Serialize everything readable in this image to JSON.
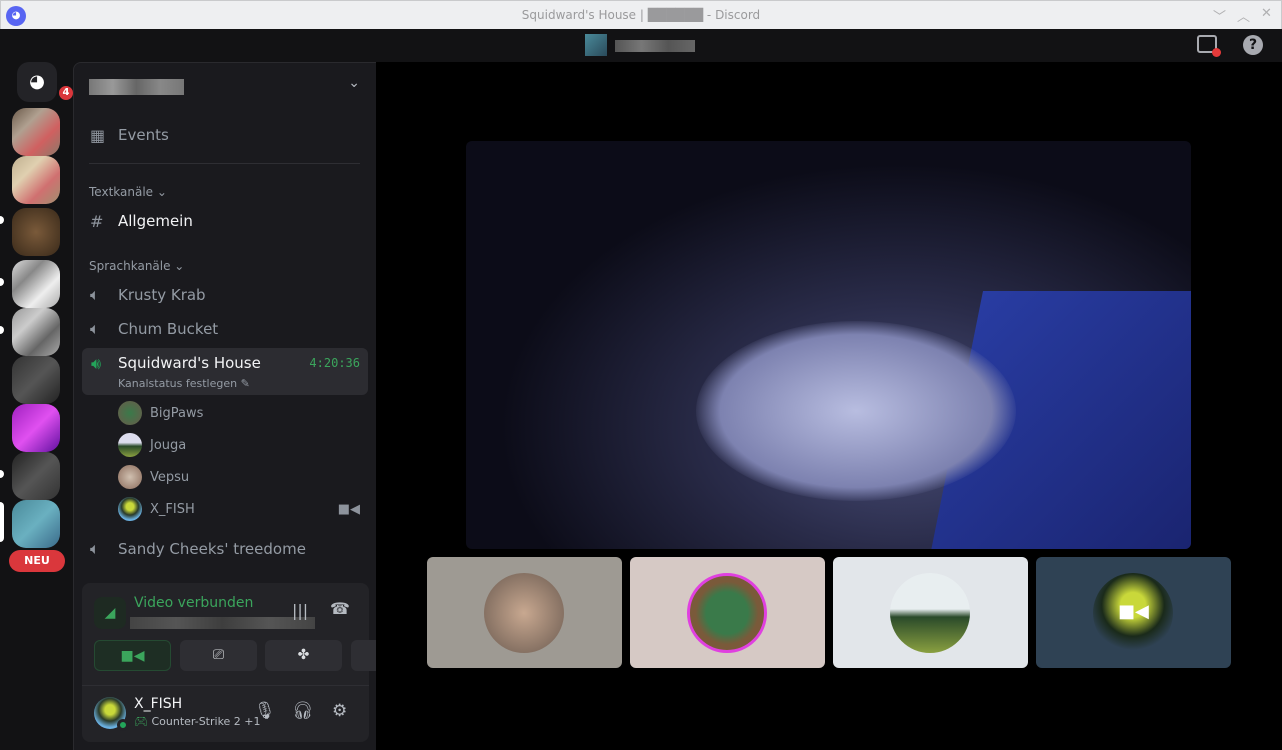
{
  "window": {
    "title": "Squidward's House | ██████ - Discord",
    "controls": {
      "minimize": "﹀",
      "maximize": "︿",
      "close": "✕"
    }
  },
  "topbar": {
    "inbox_icon": "inbox-icon",
    "help_label": "?"
  },
  "rail": {
    "home_badge": "4",
    "new_label": "NEU"
  },
  "sidebar": {
    "events_label": "Events",
    "text_category": "Textkanäle ⌄",
    "text_channels": [
      {
        "name": "Allgemein"
      }
    ],
    "voice_category": "Sprachkanäle ⌄",
    "voice_channels": [
      {
        "name": "Krusty Krab"
      },
      {
        "name": "Chum Bucket"
      },
      {
        "name": "Squidward's House",
        "timer": "4:20:36",
        "status": "Kanalstatus festlegen"
      },
      {
        "name": "Sandy Cheeks' treedome"
      }
    ],
    "members": [
      {
        "name": "BigPaws"
      },
      {
        "name": "Jouga"
      },
      {
        "name": "Vepsu"
      },
      {
        "name": "X_FISH"
      }
    ]
  },
  "voice_panel": {
    "title": "Video verbunden"
  },
  "user": {
    "name": "X_FISH",
    "activity": "Counter-Strike 2 +1"
  },
  "colors": {
    "accent": "#5865f2",
    "green": "#23a55a",
    "danger": "#da373c"
  }
}
